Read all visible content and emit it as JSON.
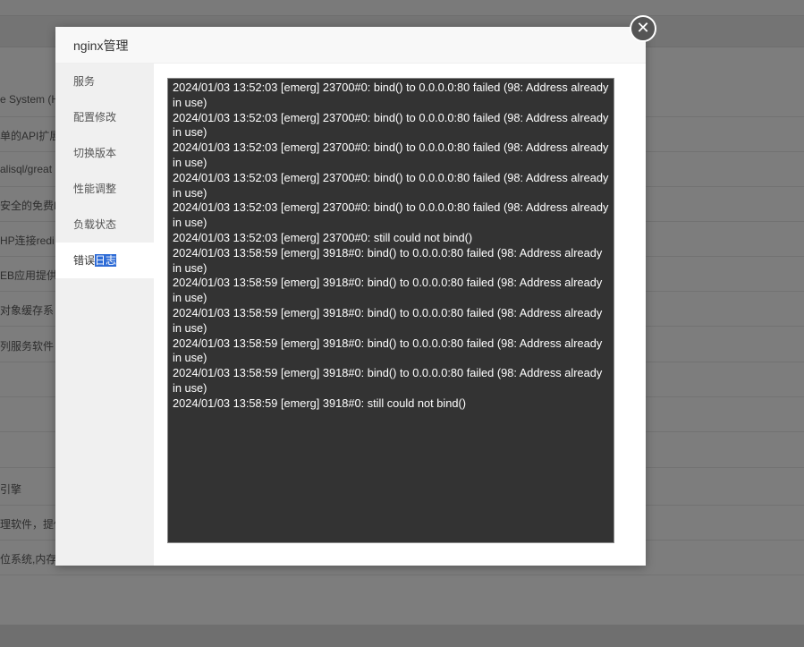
{
  "background": {
    "rows": [
      "e System (H",
      "单的API扩展",
      "alisql/great",
      "安全的免费FT",
      "HP连接redi",
      "EB应用提供",
      "对象缓存系",
      "列服务软件",
      "",
      "",
      "",
      "引擎",
      "理软件，提供",
      "位系统,内存"
    ]
  },
  "modal": {
    "title": "nginx管理",
    "close_glyph": "✕",
    "menu": [
      {
        "label": "服务"
      },
      {
        "label": "配置修改"
      },
      {
        "label": "切换版本"
      },
      {
        "label": "性能调整"
      },
      {
        "label": "负载状态"
      }
    ],
    "active_menu": {
      "label_plain": "错误",
      "label_highlight": "日志"
    },
    "log_lines": [
      "2024/01/03 13:52:03 [emerg] 23700#0: bind() to 0.0.0.0:80 failed (98: Address already in use)",
      "2024/01/03 13:52:03 [emerg] 23700#0: bind() to 0.0.0.0:80 failed (98: Address already in use)",
      "2024/01/03 13:52:03 [emerg] 23700#0: bind() to 0.0.0.0:80 failed (98: Address already in use)",
      "2024/01/03 13:52:03 [emerg] 23700#0: bind() to 0.0.0.0:80 failed (98: Address already in use)",
      "2024/01/03 13:52:03 [emerg] 23700#0: bind() to 0.0.0.0:80 failed (98: Address already in use)",
      "2024/01/03 13:52:03 [emerg] 23700#0: still could not bind()",
      "2024/01/03 13:58:59 [emerg] 3918#0: bind() to 0.0.0.0:80 failed (98: Address already in use)",
      "2024/01/03 13:58:59 [emerg] 3918#0: bind() to 0.0.0.0:80 failed (98: Address already in use)",
      "2024/01/03 13:58:59 [emerg] 3918#0: bind() to 0.0.0.0:80 failed (98: Address already in use)",
      "2024/01/03 13:58:59 [emerg] 3918#0: bind() to 0.0.0.0:80 failed (98: Address already in use)",
      "2024/01/03 13:58:59 [emerg] 3918#0: bind() to 0.0.0.0:80 failed (98: Address already in use)",
      "2024/01/03 13:58:59 [emerg] 3918#0: still could not bind()"
    ]
  },
  "colors": {
    "overlay": "#7d7d7d",
    "log_background": "#333333",
    "log_text": "#ffffff",
    "highlight": "#2d6bd6",
    "close_button": "#555555"
  }
}
